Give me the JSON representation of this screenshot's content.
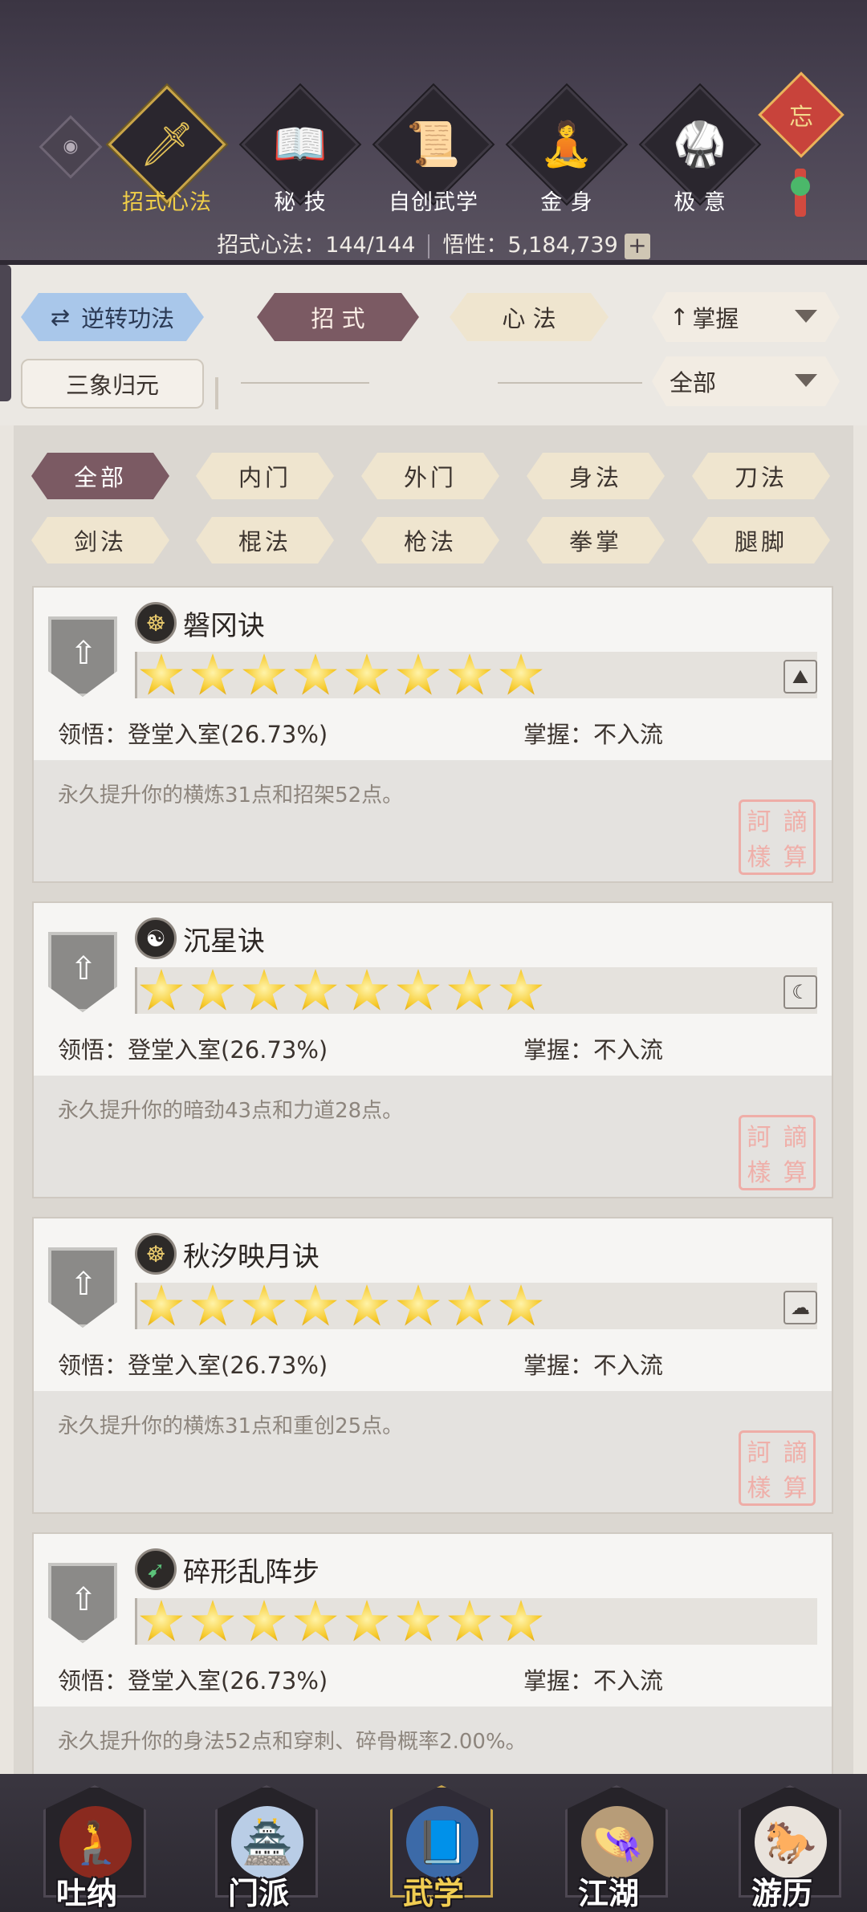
{
  "header": {
    "tabs": [
      {
        "label": "招式心法",
        "icon": "sword-icon",
        "glyph": "🗡",
        "active": true
      },
      {
        "label": "秘 技",
        "icon": "book-icon",
        "glyph": "📖",
        "active": false
      },
      {
        "label": "自创武学",
        "icon": "scroll-icon",
        "glyph": "📜",
        "active": false
      },
      {
        "label": "金 身",
        "icon": "meditation-icon",
        "glyph": "🧘",
        "active": false
      },
      {
        "label": "极 意",
        "icon": "martial-stance-icon",
        "glyph": "🥋",
        "active": false
      }
    ],
    "charm_glyph": "忘",
    "stats_label": "招式心法：",
    "stats_value": "144/144",
    "insight_label": "悟性：",
    "insight_value": "5,184,739",
    "plus": "+"
  },
  "filters": {
    "reverse_label": "逆转功法",
    "tab_zhaoshi": "招 式",
    "tab_xinfa": "心 法",
    "sort_label": "掌握",
    "sanxiang_label": "三象归元",
    "scope_label": "全部"
  },
  "categories": [
    "全部",
    "内门",
    "外门",
    "身法",
    "刀法",
    "剑法",
    "棍法",
    "枪法",
    "拳掌",
    "腿脚"
  ],
  "skills": [
    {
      "name": "磐冈诀",
      "badge": "☸",
      "badge_class": "",
      "corner": "⛰",
      "comprehension_label": "领悟：",
      "comprehension": "登堂入室(26.73%)",
      "mastery_label": "掌握：",
      "mastery": "不入流",
      "desc": "永久提升你的横炼31点和招架52点。",
      "stars": 8
    },
    {
      "name": "沉星诀",
      "badge": "☯",
      "badge_class": "yin",
      "corner": "☾",
      "comprehension_label": "领悟：",
      "comprehension": "登堂入室(26.73%)",
      "mastery_label": "掌握：",
      "mastery": "不入流",
      "desc": "永久提升你的暗劲43点和力道28点。",
      "stars": 8
    },
    {
      "name": "秋汐映月诀",
      "badge": "☸",
      "badge_class": "",
      "corner": "☁",
      "comprehension_label": "领悟：",
      "comprehension": "登堂入室(26.73%)",
      "mastery_label": "掌握：",
      "mastery": "不入流",
      "desc": "永久提升你的横炼31点和重创25点。",
      "stars": 8
    },
    {
      "name": "碎形乱阵步",
      "badge": "➹",
      "badge_class": "green",
      "corner": "",
      "comprehension_label": "领悟：",
      "comprehension": "登堂入室(26.73%)",
      "mastery_label": "掌握：",
      "mastery": "不入流",
      "desc": "永久提升你的身法52点和穿刺、碎骨概率2.00%。",
      "stars": 8
    }
  ],
  "seal_chars": [
    "訶",
    "謫",
    "樣",
    "算"
  ],
  "bottom_nav": [
    {
      "label": "吐纳",
      "icon": "monk-icon",
      "glyph": "🧎",
      "active": false
    },
    {
      "label": "门派",
      "icon": "banner-icon",
      "glyph": "🏯",
      "active": false
    },
    {
      "label": "武学",
      "icon": "manual-icon",
      "glyph": "📘",
      "active": true
    },
    {
      "label": "江湖",
      "icon": "straw-hat-icon",
      "glyph": "👒",
      "active": false
    },
    {
      "label": "游历",
      "icon": "horse-icon",
      "glyph": "🐎",
      "active": false
    }
  ],
  "colors": {
    "header_bg": "#4b4454",
    "active_gold": "#f1cf48",
    "pill_active": "#7b5a63",
    "pill_blue": "#a9c7ea",
    "seal_red": "#f0a8a2"
  }
}
